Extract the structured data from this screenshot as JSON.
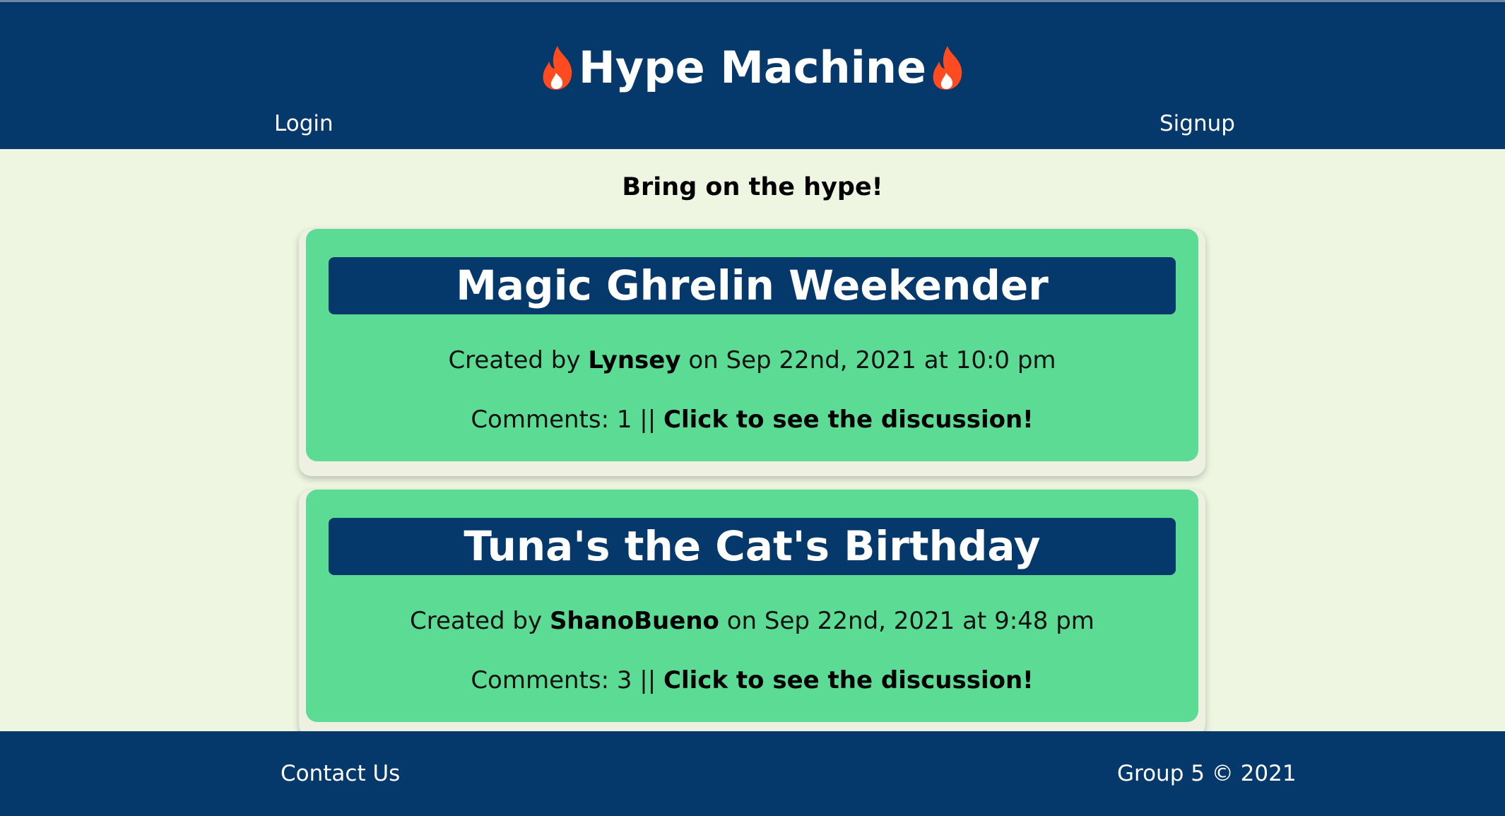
{
  "header": {
    "title": "Hype Machine",
    "icon": "fire-icon",
    "icon_color": "#ff4b1f",
    "nav": {
      "login": "Login",
      "signup": "Signup"
    }
  },
  "main": {
    "tagline": "Bring on the hype!",
    "posts": [
      {
        "title": "Magic Ghrelin Weekender",
        "created_prefix": "Created by",
        "author": "Lynsey",
        "date_text": "on Sep 22nd, 2021 at 10:0 pm",
        "comments_text": "Comments: 1 ||",
        "discussion_link": "Click to see the discussion!"
      },
      {
        "title": "Tuna's the Cat's Birthday",
        "created_prefix": "Created by",
        "author": "ShanoBueno",
        "date_text": "on Sep 22nd, 2021 at 9:48 pm",
        "comments_text": "Comments: 3 ||",
        "discussion_link": "Click to see the discussion!"
      }
    ]
  },
  "footer": {
    "contact": "Contact Us",
    "copyright": "Group 5 © 2021"
  },
  "colors": {
    "navy": "#05386b",
    "green": "#5cdb95",
    "background": "#eef5e0"
  }
}
